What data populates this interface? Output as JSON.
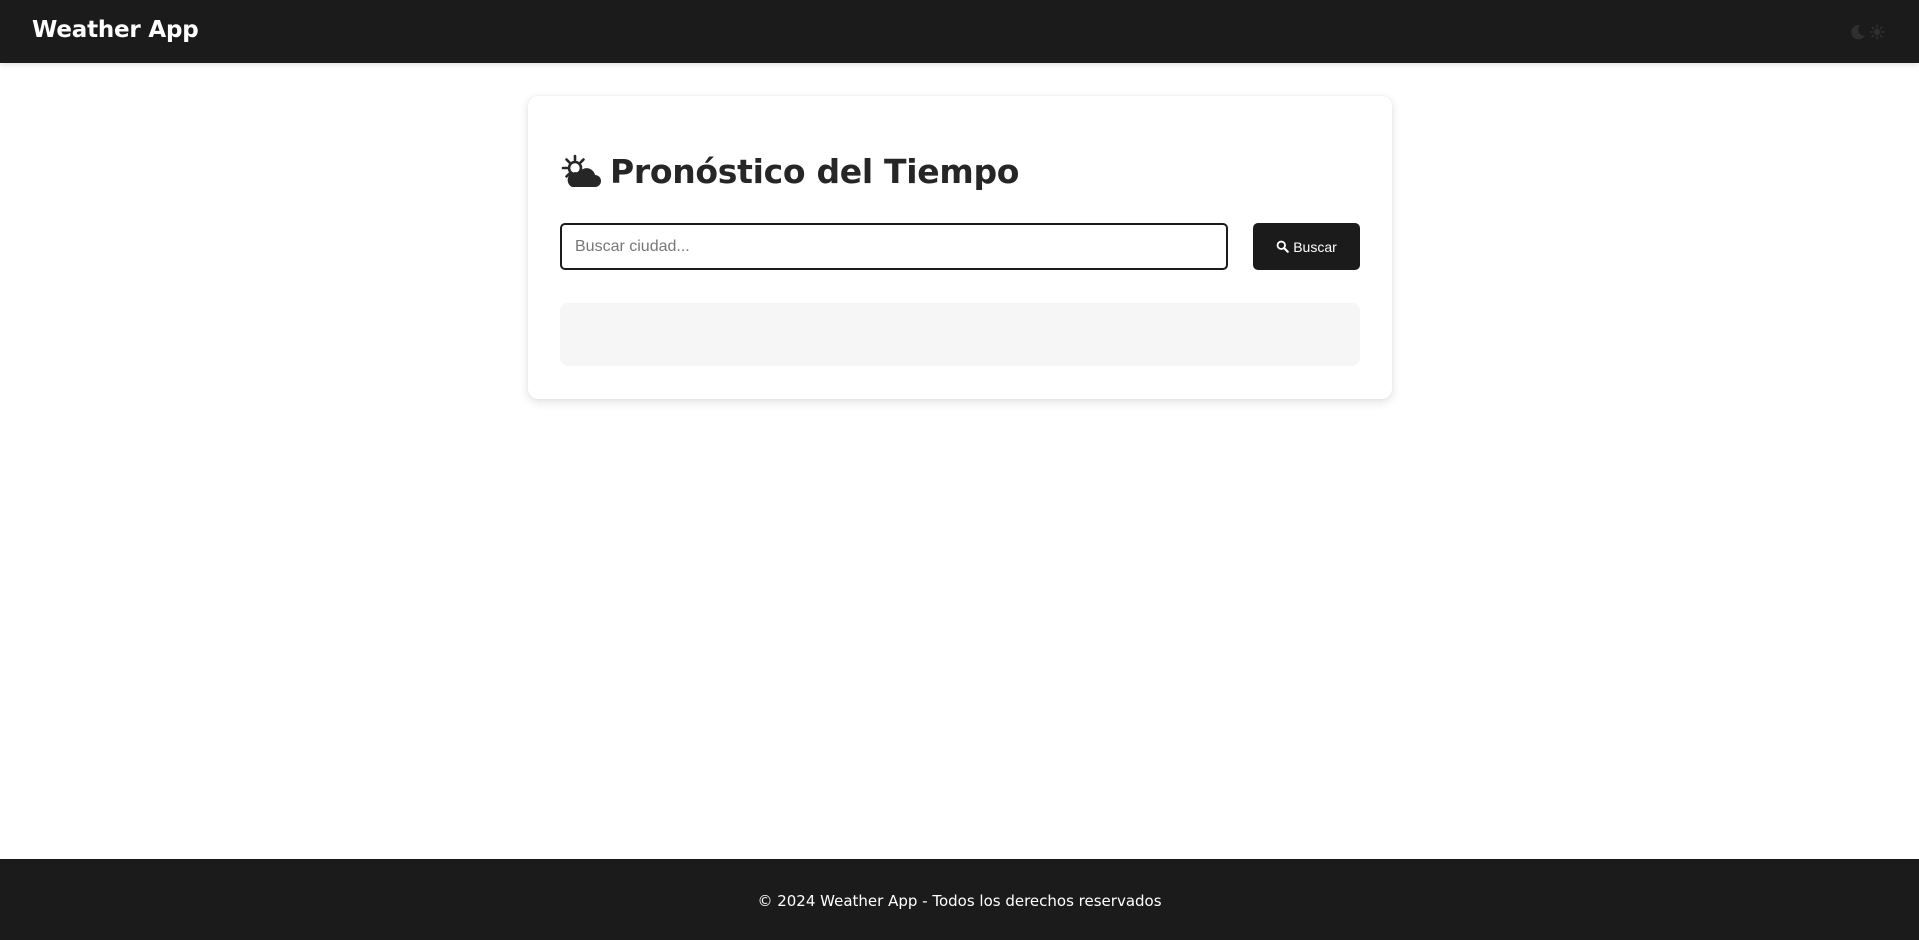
{
  "navbar": {
    "brand": "Weather App",
    "theme_toggle": {
      "icons": [
        "moon-icon",
        "sun-icon"
      ]
    }
  },
  "card": {
    "title_icon": "sun-behind-cloud-icon",
    "title": "Pronóstico del Tiempo",
    "search": {
      "placeholder": "Buscar ciudad...",
      "value": ""
    },
    "search_button": {
      "icon": "search-icon",
      "label": "Buscar"
    }
  },
  "footer": {
    "text": "© 2024 Weather App - Todos los derechos reservados"
  },
  "colors": {
    "dark": "#1b1b1b",
    "text": "#262626",
    "results_bg": "#f6f6f6",
    "white": "#ffffff"
  }
}
